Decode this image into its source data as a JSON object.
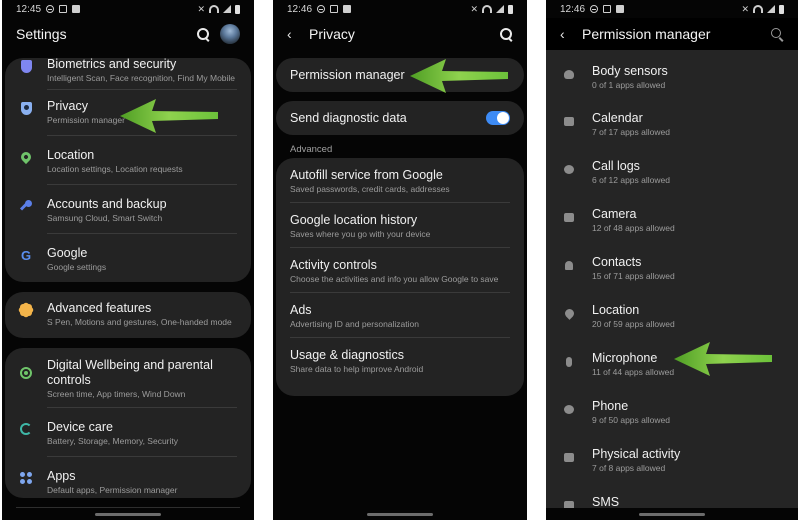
{
  "panels": {
    "settings": {
      "status": {
        "time": "12:45"
      },
      "title": "Settings",
      "card1": [
        {
          "title": "Biometrics and security",
          "subtitle": "Intelligent Scan, Face recognition, Find My Mobile",
          "icon": "shield-icon"
        },
        {
          "title": "Privacy",
          "subtitle": "Permission manager",
          "icon": "privacy-shield-icon"
        },
        {
          "title": "Location",
          "subtitle": "Location settings, Location requests",
          "icon": "location-pin-icon"
        },
        {
          "title": "Accounts and backup",
          "subtitle": "Samsung Cloud, Smart Switch",
          "icon": "key-icon"
        },
        {
          "title": "Google",
          "subtitle": "Google settings",
          "icon": "google-icon"
        }
      ],
      "card2": [
        {
          "title": "Advanced features",
          "subtitle": "S Pen, Motions and gestures, One-handed mode",
          "icon": "advanced-features-icon"
        }
      ],
      "card3": [
        {
          "title": "Digital Wellbeing and parental controls",
          "subtitle": "Screen time, App timers, Wind Down",
          "icon": "digital-wellbeing-icon"
        },
        {
          "title": "Device care",
          "subtitle": "Battery, Storage, Memory, Security",
          "icon": "device-care-icon"
        },
        {
          "title": "Apps",
          "subtitle": "Default apps, Permission manager",
          "icon": "apps-icon"
        }
      ],
      "google_letter": "G"
    },
    "privacy": {
      "status": {
        "time": "12:46"
      },
      "back": "‹",
      "title": "Privacy",
      "permission_manager": "Permission manager",
      "send_diagnostic": {
        "label": "Send diagnostic data",
        "on": true
      },
      "section_label": "Advanced",
      "advanced": [
        {
          "title": "Autofill service from Google",
          "subtitle": "Saved passwords, credit cards, addresses"
        },
        {
          "title": "Google location history",
          "subtitle": "Saves where you go with your device"
        },
        {
          "title": "Activity controls",
          "subtitle": "Choose the activities and info you allow Google to save"
        },
        {
          "title": "Ads",
          "subtitle": "Advertising ID and personalization"
        },
        {
          "title": "Usage & diagnostics",
          "subtitle": "Share data to help improve Android"
        }
      ]
    },
    "permission_manager": {
      "status": {
        "time": "12:46"
      },
      "back": "‹",
      "title": "Permission manager",
      "items": [
        {
          "title": "Body sensors",
          "subtitle": "0 of 1 apps allowed",
          "icon": "heart-monitor-icon"
        },
        {
          "title": "Calendar",
          "subtitle": "7 of 17 apps allowed",
          "icon": "calendar-icon"
        },
        {
          "title": "Call logs",
          "subtitle": "6 of 12 apps allowed",
          "icon": "call-log-icon"
        },
        {
          "title": "Camera",
          "subtitle": "12 of 48 apps allowed",
          "icon": "camera-icon"
        },
        {
          "title": "Contacts",
          "subtitle": "15 of 71 apps allowed",
          "icon": "contacts-icon"
        },
        {
          "title": "Location",
          "subtitle": "20 of 59 apps allowed",
          "icon": "location-icon"
        },
        {
          "title": "Microphone",
          "subtitle": "11 of 44 apps allowed",
          "icon": "microphone-icon"
        },
        {
          "title": "Phone",
          "subtitle": "9 of 50 apps allowed",
          "icon": "phone-icon"
        },
        {
          "title": "Physical activity",
          "subtitle": "7 of 8 apps allowed",
          "icon": "physical-activity-icon"
        },
        {
          "title": "SMS",
          "subtitle": "",
          "icon": "sms-icon"
        }
      ]
    }
  },
  "annotations": {
    "arrow_color": "#6cc23a"
  }
}
